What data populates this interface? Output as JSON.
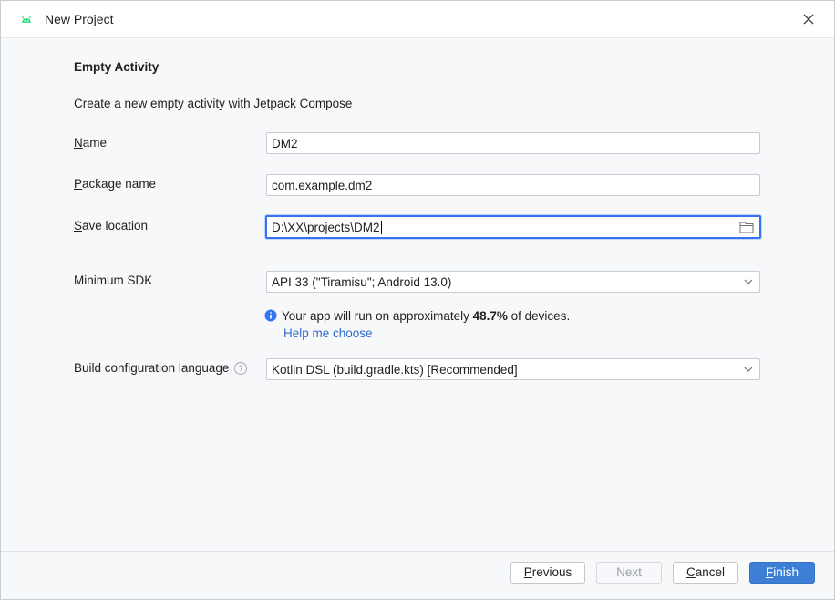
{
  "window": {
    "title": "New Project",
    "app_icon": "android-icon",
    "close_icon": "close-icon"
  },
  "form": {
    "heading": "Empty Activity",
    "description": "Create a new empty activity with Jetpack Compose",
    "name": {
      "label_mnemonic": "N",
      "label_rest": "ame",
      "value": "DM2"
    },
    "package": {
      "label_mnemonic": "P",
      "label_rest": "ackage name",
      "value": "com.example.dm2"
    },
    "save_location": {
      "label_mnemonic": "S",
      "label_rest": "ave location",
      "value": "D:\\XX\\projects\\DM2",
      "icon": "folder-icon"
    },
    "min_sdk": {
      "label": "Minimum SDK",
      "value": "API 33 (\"Tiramisu\"; Android 13.0)"
    },
    "info": {
      "icon": "info-icon",
      "prefix": "Your app will run on approximately ",
      "percentage": "48.7%",
      "suffix": " of devices.",
      "link": "Help me choose"
    },
    "build_language": {
      "label": "Build configuration language",
      "help_icon": "?",
      "value": "Kotlin DSL (build.gradle.kts) [Recommended]"
    }
  },
  "footer": {
    "previous": {
      "mnemonic": "P",
      "rest": "revious"
    },
    "next": {
      "label": "Next"
    },
    "cancel": {
      "mnemonic": "C",
      "rest": "ancel"
    },
    "finish": {
      "mnemonic": "F",
      "rest": "inish"
    }
  },
  "colors": {
    "accent": "#3574f0",
    "primary_button": "#3d7fd6",
    "link": "#2f6bc8",
    "android_green": "#3ddc84"
  }
}
